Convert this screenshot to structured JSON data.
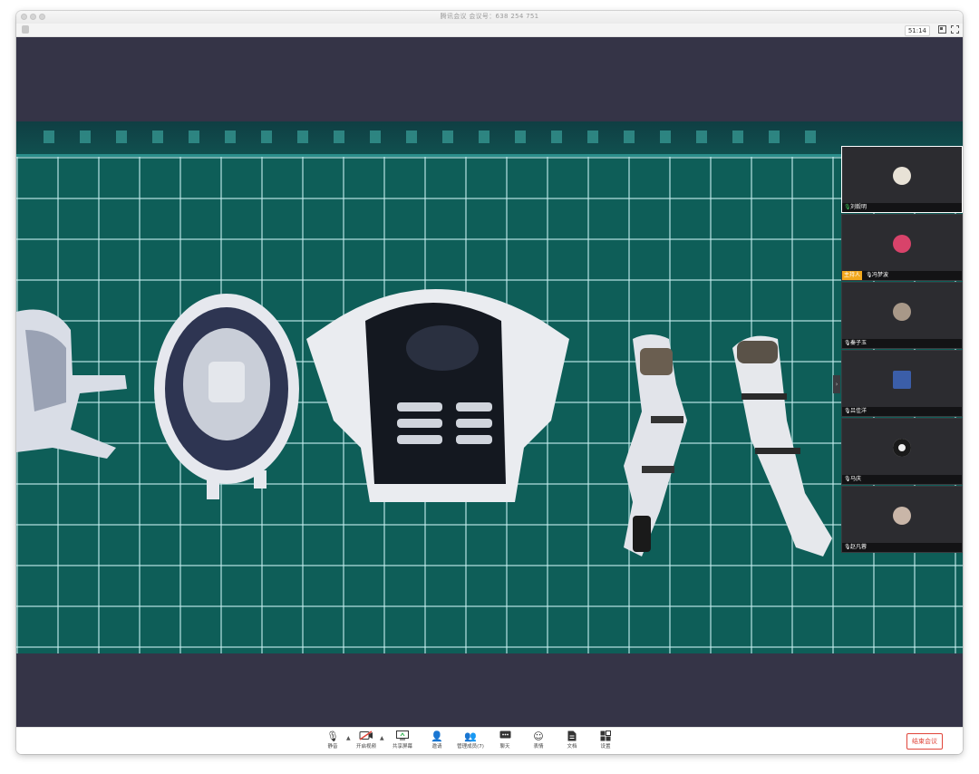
{
  "window": {
    "title": "腾讯会议 会议号：638 254 751"
  },
  "topbar": {
    "timer": "51:14"
  },
  "participants": [
    {
      "name": "刘毅明",
      "active": true,
      "host": false,
      "avatar_color": "#e8e2d6"
    },
    {
      "name": "冯梦波",
      "active": false,
      "host": true,
      "host_label": "主持人",
      "avatar_color": "#d8436a"
    },
    {
      "name": "秦子玉",
      "active": false,
      "host": false,
      "avatar_color": "#a89888"
    },
    {
      "name": "吕佳洋",
      "active": false,
      "host": false,
      "avatar_color": "#3b5ea8"
    },
    {
      "name": "马庆",
      "active": false,
      "host": false,
      "avatar_color": "#f0f0f0"
    },
    {
      "name": "赵凡蓉",
      "active": false,
      "host": false,
      "avatar_color": "#c9b6a8"
    }
  ],
  "controls": {
    "mute": "静音",
    "video": "开启视频",
    "share": "共享屏幕",
    "invite": "邀请",
    "members": "管理成员(7)",
    "chat": "聊天",
    "emoji": "表情",
    "docs": "文档",
    "settings": "设置",
    "end": "结束会议"
  },
  "colors": {
    "stage_bg": "#353447",
    "mat_green": "#0e5e58",
    "end_red": "#e0453a",
    "host_badge": "#f2a81d"
  }
}
